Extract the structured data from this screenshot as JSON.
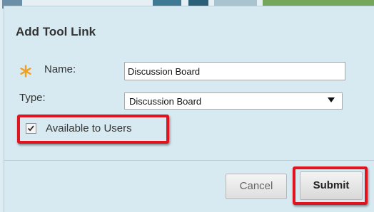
{
  "dialog": {
    "title": "Add Tool Link",
    "name_label": "Name:",
    "name_value": "Discussion Board",
    "type_label": "Type:",
    "type_selected": "Discussion Board",
    "available_label": "Available to Users",
    "available_checked": true,
    "cancel_label": "Cancel",
    "submit_label": "Submit"
  },
  "colors": {
    "background": "#dcecf2",
    "required_star": "#f0a020",
    "highlight": "#e0141e"
  }
}
